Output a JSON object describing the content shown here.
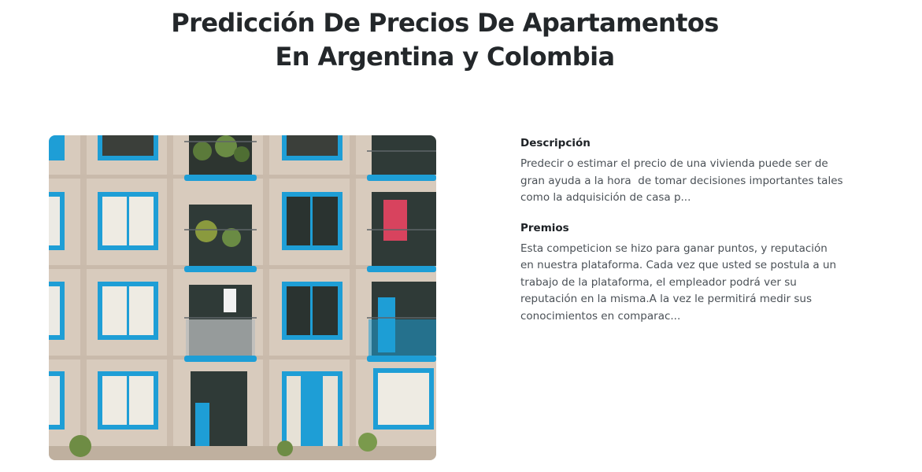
{
  "page": {
    "title_line1": "Predicción De Precios De Apartamentos",
    "title_line2": "En Argentina y Colombia"
  },
  "hero_image": {
    "icon": "apartment-building-photo",
    "colors": {
      "facade": "#d9cbbd",
      "frame": "#1e9ed6",
      "glass": "#2f3a37"
    }
  },
  "description": {
    "heading": "Descripción",
    "text": "Predecir o estimar el precio de una vivienda puede ser de gran ayuda a la hora  de tomar decisiones importantes tales como la adquisición de casa p..."
  },
  "prizes": {
    "heading": "Premios",
    "text": "Esta competicion se hizo para ganar puntos, y reputación en nuestra plataforma. Cada vez que usted se postula a un trabajo de la plataforma, el empleador podrá ver su reputación en la misma.A la vez le permitirá medir sus conocimientos en comparac..."
  }
}
